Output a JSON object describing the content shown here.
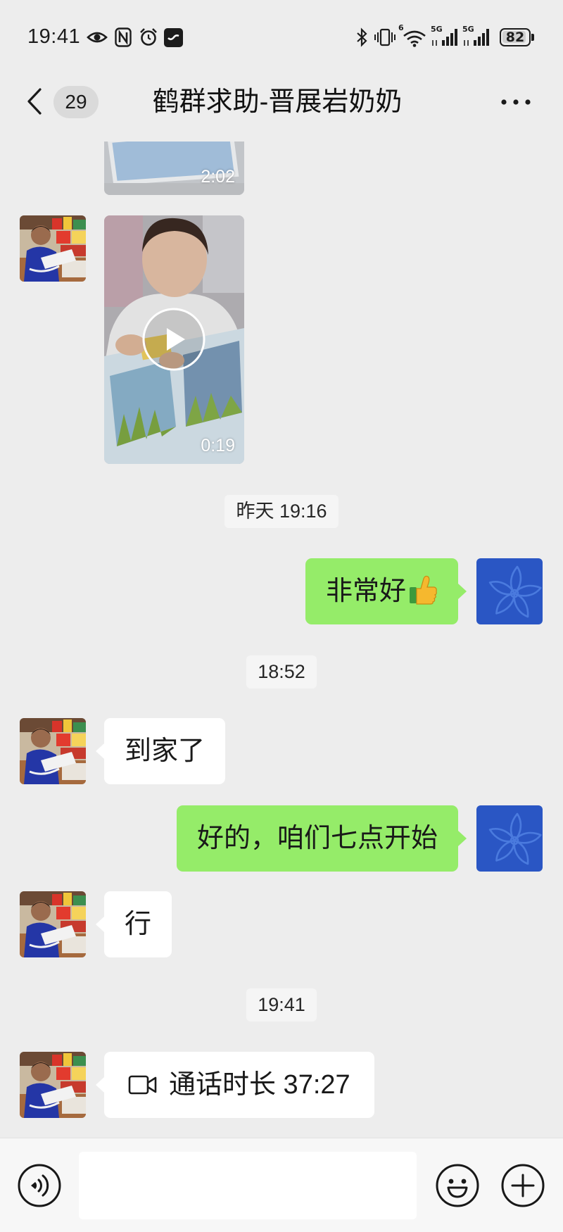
{
  "status_bar": {
    "time": "19:41",
    "left_icons": [
      "eye-icon",
      "nfc-icon",
      "alarm-icon",
      "app-notification-icon"
    ],
    "right_icons": [
      "bluetooth-icon",
      "vibrate-icon",
      "wifi-icon",
      "signal-icon",
      "signal-icon",
      "battery-icon"
    ],
    "wifi_label": "6",
    "sim1_label": "5G",
    "sim2_label": "5G",
    "battery_level": "82"
  },
  "header": {
    "back_icon": "chevron-left-icon",
    "unread_count": "29",
    "title": "鹤群求助-晋展岩奶奶",
    "more_icon": "more-dots-icon"
  },
  "chat": {
    "items": [
      {
        "video": {
          "duration": "2:02",
          "icon": "play-icon"
        },
        "outgoing": false
      },
      {
        "video": {
          "duration": "0:19",
          "icon": "play-icon"
        },
        "outgoing": false
      },
      {
        "timestamp": "昨天 19:16"
      },
      {
        "text": "非常好",
        "emoji": "thumbs-up-emoji",
        "outgoing": true
      },
      {
        "timestamp": "18:52"
      },
      {
        "text": "到家了",
        "outgoing": false
      },
      {
        "text": "好的，咱们七点开始",
        "outgoing": true
      },
      {
        "text": "行",
        "outgoing": false
      },
      {
        "timestamp": "19:41"
      },
      {
        "call": {
          "icon": "video-camera-icon",
          "text": "通话时长 37:27"
        },
        "outgoing": false
      }
    ]
  },
  "input_bar": {
    "voice_icon": "voice-input-icon",
    "input_value": "",
    "emoji_icon": "emoji-icon",
    "more_icon": "plus-circle-icon"
  },
  "colors": {
    "chat_background": "#ededed",
    "outgoing_bubble": "#95ec69",
    "incoming_bubble": "#ffffff",
    "input_bar": "#f7f7f7"
  }
}
